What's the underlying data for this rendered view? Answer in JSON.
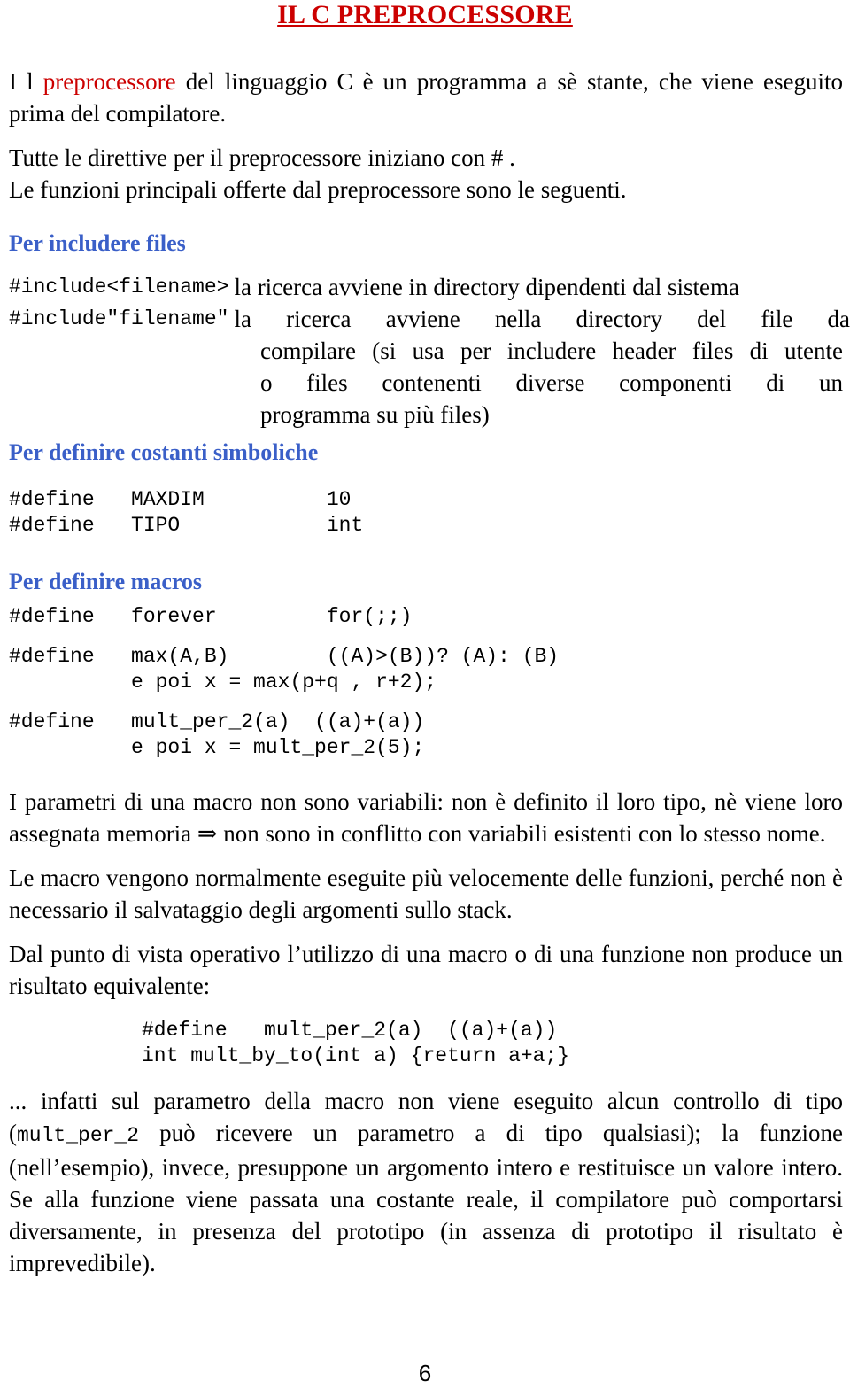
{
  "document": {
    "title": "IL C PREPROCESSORE",
    "page_number": "6",
    "colors": {
      "title_red": "#cc0000",
      "heading_blue": "#3a5fc8",
      "body_black": "#000000"
    }
  },
  "intro": {
    "line1_a": "I l ",
    "line1_highlight": "preprocessore",
    "line1_b": " del linguaggio C è un programma a sè stante, che viene eseguito prima del compilatore.",
    "para2": "Tutte le direttive per il preprocessore iniziano con # .",
    "para3": "Le funzioni principali offerte dal preprocessore sono le seguenti."
  },
  "sections": {
    "include": {
      "heading": "Per includere files",
      "rows": [
        {
          "key": "#include<filename>",
          "desc": "la ricerca avviene in directory dipendenti dal sistema"
        },
        {
          "key": "#include\"filename\"",
          "desc": "la ricerca avviene nella directory del file da"
        }
      ],
      "continuation": [
        "compilare (si usa per includere header files di utente",
        "o files contenenti diverse componenti di un",
        "programma su più files)"
      ]
    },
    "costanti": {
      "heading": "Per definire  costanti simboliche",
      "code": [
        "#define   MAXDIM          10",
        "#define   TIPO            int"
      ]
    },
    "macros": {
      "heading": "Per definire macros",
      "code_forever": [
        "#define   forever         for(;;)"
      ],
      "code_max": [
        "#define   max(A,B)        ((A)>(B))? (A): (B)",
        "          e poi x = max(p+q , r+2);"
      ],
      "code_mult": [
        "#define   mult_per_2(a)  ((a)+(a))",
        "          e poi x = mult_per_2(5);"
      ]
    }
  },
  "notes": {
    "para_parametri": "I parametri di una macro non sono variabili: non è definito il loro tipo, nè viene loro assegnata memoria ⇒ non sono in conflitto con variabili esistenti con lo stesso nome.",
    "para_velocita": "Le macro vengono normalmente eseguite più velocemente delle funzioni, perché non è necessario il salvataggio degli argomenti sullo stack.",
    "para_operativo": "Dal punto di vista operativo l’utilizzo di una macro o di una funzione non produce un risultato equivalente:",
    "code_compare": [
      "#define   mult_per_2(a)  ((a)+(a))",
      "int mult_by_to(int a) {return a+a;}"
    ],
    "final_a": "... infatti sul parametro della macro non viene eseguito alcun controllo di tipo (",
    "final_code": "mult_per_2",
    "final_b": " può ricevere un parametro a di tipo qualsiasi); la funzione (nell’esempio), invece, presuppone un argomento intero e restituisce un valore intero. Se alla funzione viene passata una costante reale, il compilatore può comportarsi diversamente, in presenza del prototipo (in assenza di prototipo il risultato è imprevedibile)."
  }
}
